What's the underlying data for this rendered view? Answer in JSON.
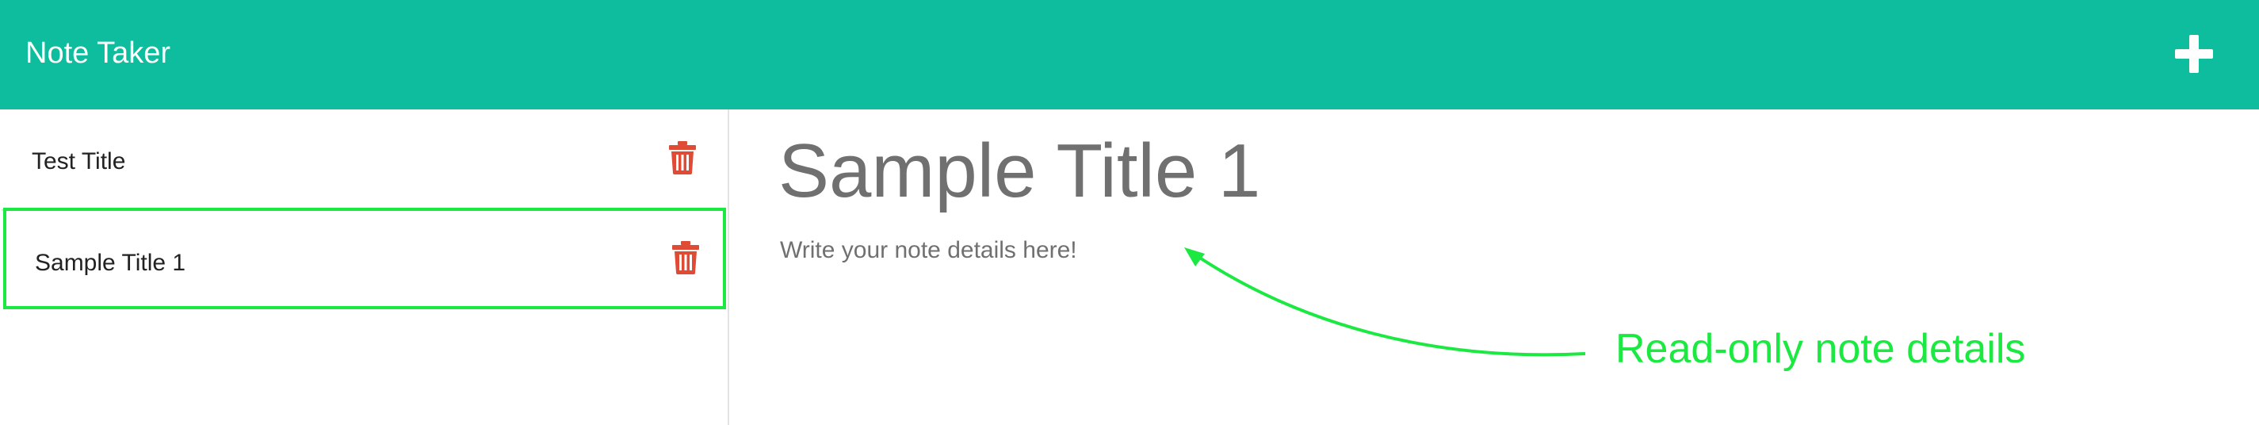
{
  "colors": {
    "navbar": "#0ebd9d",
    "delete_icon": "#e04b36",
    "annotation": "#1be941",
    "selection_border": "#1be941"
  },
  "navbar": {
    "brand": "Note Taker",
    "add_icon": "plus-icon"
  },
  "sidebar": {
    "notes": [
      {
        "title": "Test Title",
        "delete_icon": "trash-icon"
      },
      {
        "title": "Sample Title 1",
        "delete_icon": "trash-icon",
        "selected": true
      }
    ]
  },
  "detail": {
    "title": "Sample Title 1",
    "body": "Write your note details here!"
  },
  "annotation": {
    "label": "Read-only note details"
  }
}
